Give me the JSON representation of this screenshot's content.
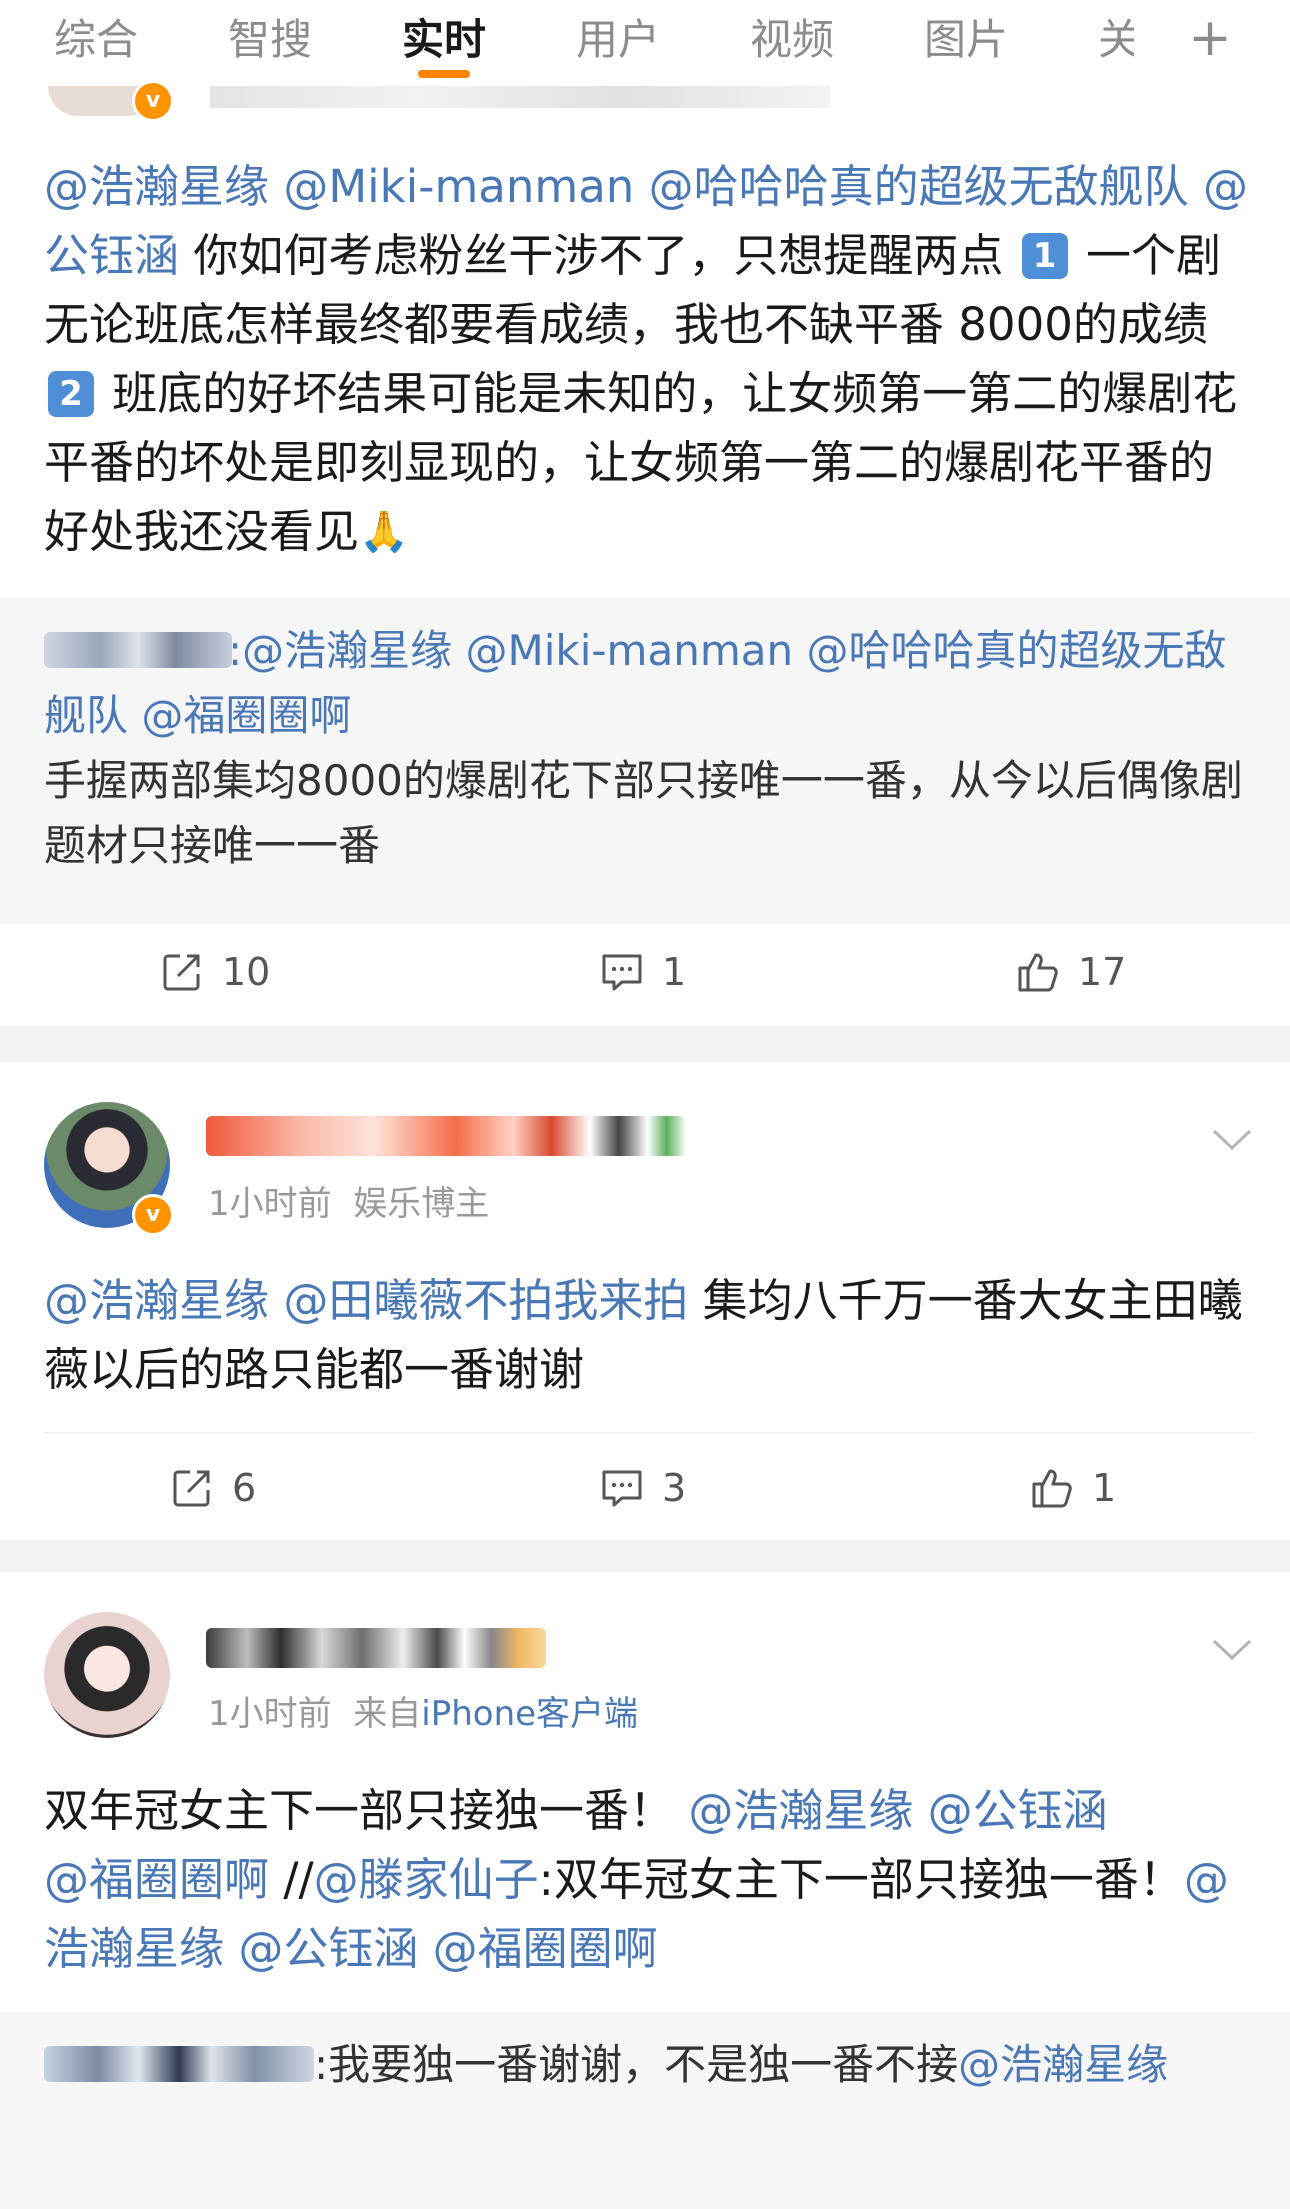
{
  "tabs": [
    {
      "label": "综合"
    },
    {
      "label": "智搜"
    },
    {
      "label": "实时"
    },
    {
      "label": "用户"
    },
    {
      "label": "视频"
    },
    {
      "label": "图片"
    },
    {
      "label": "关"
    }
  ],
  "accent_color": "#ff8200",
  "link_color": "#4a78b6",
  "posts": [
    {
      "content": {
        "m1": "@浩瀚星缘",
        "m2": "@Miki-manman",
        "m3": "@哈哈哈真的超级无敌舰队",
        "m4": "@公钰涵",
        "t1": " 你如何考虑粉丝干涉不了，只想提醒两点 ",
        "n1": "1",
        "t2": " 一个剧无论班底怎样最终都要看成绩，我也不缺平番 8000的成绩 ",
        "n2": "2",
        "t3": " 班底的好坏结果可能是未知的，让女频第一第二的爆剧花平番的坏处是即刻显现的，让女频第一第二的爆剧花平番的好处我还没看见",
        "emoji": "🙏"
      },
      "retweet": {
        "m1": ":@浩瀚星缘",
        "m2": " @Miki-manman",
        "m3": " @哈哈哈真的超级无敌舰队",
        "m4": " @福圈圈啊",
        "text": "手握两部集均8000的爆剧花下部只接唯一一番，从今以后偶像剧题材只接唯一一番"
      },
      "actions": {
        "repost": "10",
        "comment": "1",
        "like": "17"
      }
    },
    {
      "time": "1小时前",
      "role": "娱乐博主",
      "content": {
        "m1": "@浩瀚星缘",
        "m2": " @田曦薇不拍我来拍",
        "t1": " 集均八千万一番大女主田曦薇以后的路只能都一番谢谢"
      },
      "actions": {
        "repost": "6",
        "comment": "3",
        "like": "1"
      }
    },
    {
      "time": "1小时前",
      "source": "来自",
      "source_link": "iPhone客户端",
      "content": {
        "t1": "双年冠女主下一部只接独一番！",
        "m1": " @浩瀚星缘",
        "m2": "  @公钰涵",
        "m3": "@福圈圈啊",
        "t2": " //",
        "m4": "@滕家仙子",
        "t3": ":双年冠女主下一部只接独一番！",
        "m5": "@浩瀚星缘",
        "m6": "  @公钰涵",
        "m7": " @福圈圈啊"
      },
      "retweet": {
        "text": ":我要独一番谢谢，不是独一番不接",
        "m1": "@浩瀚星缘"
      }
    }
  ]
}
